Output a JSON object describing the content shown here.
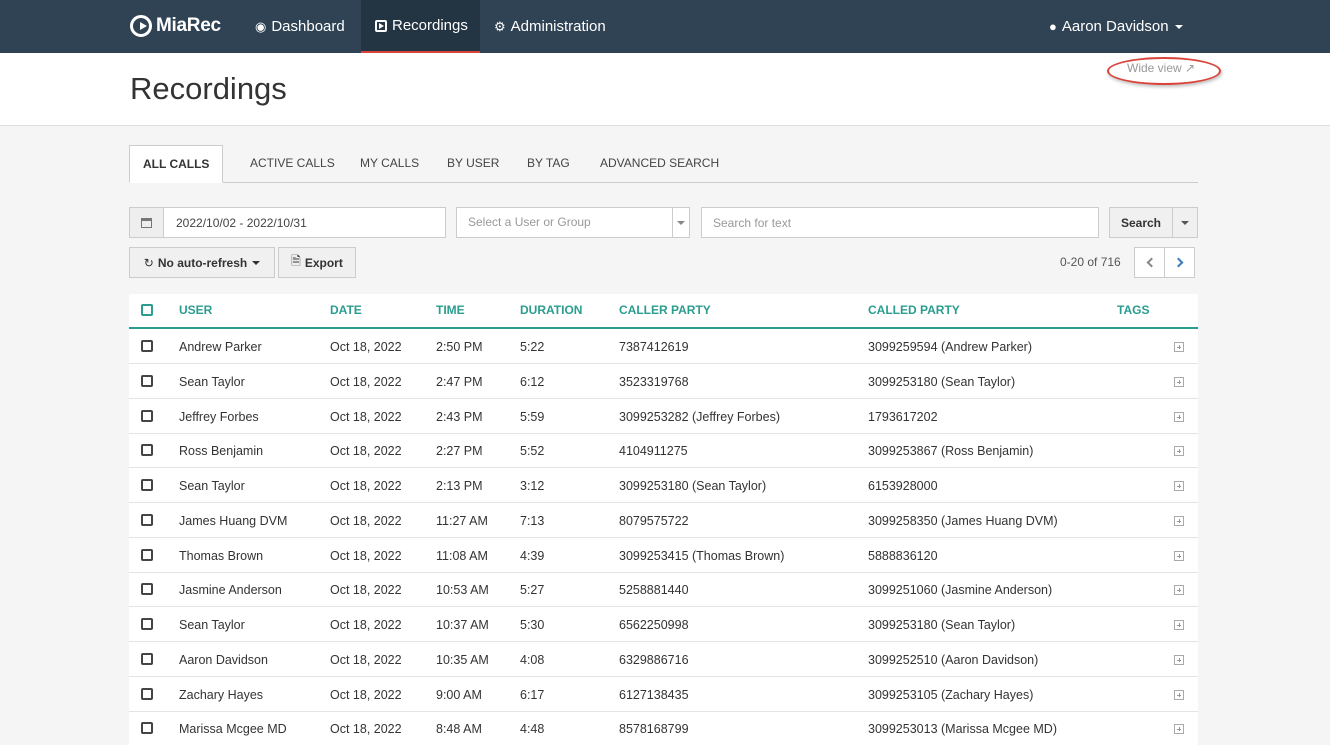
{
  "nav": {
    "brand": "MiaRec",
    "items": [
      {
        "label": "Dashboard",
        "icon": "dashboard-icon"
      },
      {
        "label": "Recordings",
        "icon": "play-icon"
      },
      {
        "label": "Administration",
        "icon": "gear-icon"
      }
    ],
    "user": "Aaron Davidson"
  },
  "header": {
    "title": "Recordings",
    "wide_view": "Wide view"
  },
  "tabs": [
    "ALL CALLS",
    "ACTIVE CALLS",
    "MY CALLS",
    "BY USER",
    "BY TAG",
    "ADVANCED SEARCH"
  ],
  "filters": {
    "date_range": "2022/10/02 - 2022/10/31",
    "user_select_placeholder": "Select a User or Group",
    "search_placeholder": "Search for text",
    "search_button": "Search",
    "refresh_label": "No auto-refresh",
    "export_label": "Export"
  },
  "pager": {
    "info": "0-20 of 716"
  },
  "table": {
    "columns": [
      "USER",
      "DATE",
      "TIME",
      "DURATION",
      "CALLER PARTY",
      "CALLED PARTY",
      "TAGS"
    ],
    "rows": [
      {
        "user": "Andrew Parker",
        "date": "Oct 18, 2022",
        "time": "2:50 PM",
        "duration": "5:22",
        "caller": "7387412619",
        "called": "3099259594 (Andrew Parker)"
      },
      {
        "user": "Sean Taylor",
        "date": "Oct 18, 2022",
        "time": "2:47 PM",
        "duration": "6:12",
        "caller": "3523319768",
        "called": "3099253180 (Sean Taylor)"
      },
      {
        "user": "Jeffrey Forbes",
        "date": "Oct 18, 2022",
        "time": "2:43 PM",
        "duration": "5:59",
        "caller": "3099253282 (Jeffrey Forbes)",
        "called": "1793617202"
      },
      {
        "user": "Ross Benjamin",
        "date": "Oct 18, 2022",
        "time": "2:27 PM",
        "duration": "5:52",
        "caller": "4104911275",
        "called": "3099253867 (Ross Benjamin)"
      },
      {
        "user": "Sean Taylor",
        "date": "Oct 18, 2022",
        "time": "2:13 PM",
        "duration": "3:12",
        "caller": "3099253180 (Sean Taylor)",
        "called": "6153928000"
      },
      {
        "user": "James Huang DVM",
        "date": "Oct 18, 2022",
        "time": "11:27 AM",
        "duration": "7:13",
        "caller": "8079575722",
        "called": "3099258350 (James Huang DVM)"
      },
      {
        "user": "Thomas Brown",
        "date": "Oct 18, 2022",
        "time": "11:08 AM",
        "duration": "4:39",
        "caller": "3099253415 (Thomas Brown)",
        "called": "5888836120"
      },
      {
        "user": "Jasmine Anderson",
        "date": "Oct 18, 2022",
        "time": "10:53 AM",
        "duration": "5:27",
        "caller": "5258881440",
        "called": "3099251060 (Jasmine Anderson)"
      },
      {
        "user": "Sean Taylor",
        "date": "Oct 18, 2022",
        "time": "10:37 AM",
        "duration": "5:30",
        "caller": "6562250998",
        "called": "3099253180 (Sean Taylor)"
      },
      {
        "user": "Aaron Davidson",
        "date": "Oct 18, 2022",
        "time": "10:35 AM",
        "duration": "4:08",
        "caller": "6329886716",
        "called": "3099252510 (Aaron Davidson)"
      },
      {
        "user": "Zachary Hayes",
        "date": "Oct 18, 2022",
        "time": "9:00 AM",
        "duration": "6:17",
        "caller": "6127138435",
        "called": "3099253105 (Zachary Hayes)"
      },
      {
        "user": "Marissa Mcgee MD",
        "date": "Oct 18, 2022",
        "time": "8:48 AM",
        "duration": "4:48",
        "caller": "8578168799",
        "called": "3099253013 (Marissa Mcgee MD)"
      }
    ]
  },
  "colors": {
    "navbar": "#2f4354",
    "accent_teal": "#2a9d8f",
    "active_underline": "#d9443a"
  }
}
